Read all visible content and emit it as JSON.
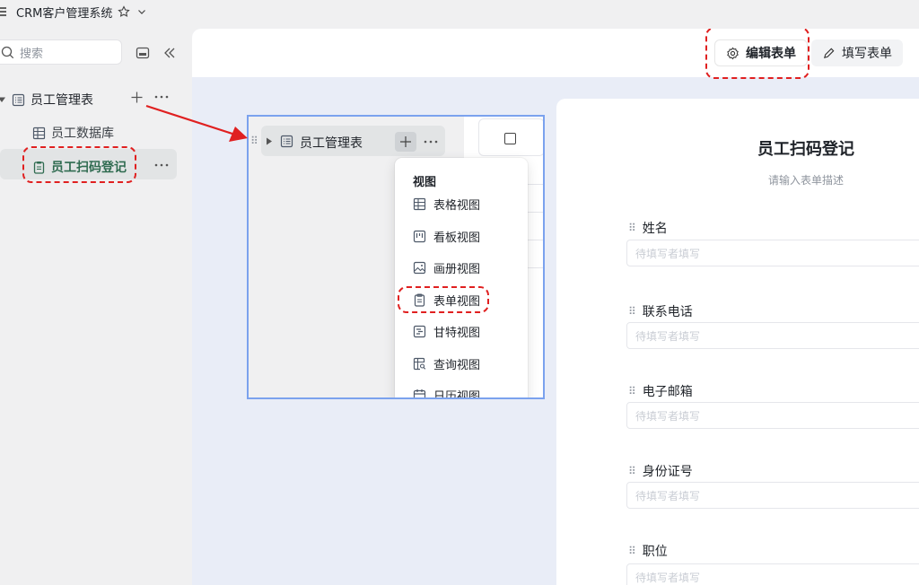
{
  "app": {
    "title": "CRM客户管理系统"
  },
  "sidebar": {
    "search_placeholder": "搜索",
    "tree": {
      "parent_label": "员工管理表",
      "children": [
        {
          "label": "员工数据库",
          "icon": "grid-table-icon"
        },
        {
          "label": "员工扫码登记",
          "icon": "clipboard-form-icon"
        }
      ]
    }
  },
  "topbar": {
    "edit_form_label": "编辑表单",
    "fill_form_label": "填写表单"
  },
  "inset": {
    "row_label": "员工管理表",
    "menu_title": "视图",
    "menu_items": [
      {
        "label": "表格视图",
        "icon": "table-icon"
      },
      {
        "label": "看板视图",
        "icon": "kanban-icon"
      },
      {
        "label": "画册视图",
        "icon": "gallery-icon"
      },
      {
        "label": "表单视图",
        "icon": "form-icon"
      },
      {
        "label": "甘特视图",
        "icon": "gantt-icon"
      },
      {
        "label": "查询视图",
        "icon": "query-icon"
      },
      {
        "label": "日历视图",
        "icon": "calendar-icon"
      }
    ]
  },
  "form": {
    "title": "员工扫码登记",
    "description": "请输入表单描述",
    "fields": [
      {
        "label": "姓名",
        "placeholder": "待填写者填写"
      },
      {
        "label": "联系电话",
        "placeholder": "待填写者填写"
      },
      {
        "label": "电子邮箱",
        "placeholder": "待填写者填写"
      },
      {
        "label": "身份证号",
        "placeholder": "待填写者填写"
      },
      {
        "label": "职位",
        "placeholder": "待填写者填写"
      }
    ]
  },
  "colors": {
    "highlight": "#e02020",
    "accent_blue": "#7ba2ee",
    "selected_text": "#2f6b50"
  }
}
